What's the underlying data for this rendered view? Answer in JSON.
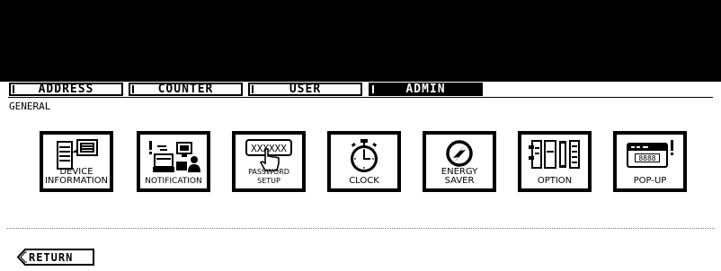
{
  "tabs": [
    {
      "label": "ADDRESS",
      "active": false
    },
    {
      "label": "COUNTER",
      "active": false
    },
    {
      "label": "USER",
      "active": false
    },
    {
      "label": "ADMIN",
      "active": true
    }
  ],
  "section_label": "GENERAL",
  "buttons": [
    {
      "label": "DEVICE\nINFORMATION",
      "icon": "device-information-icon"
    },
    {
      "label": "NOTIFICATION",
      "icon": "notification-icon"
    },
    {
      "label": "PASSWORD SETUP",
      "icon": "password-setup-icon",
      "icon_text": "XXXXXX"
    },
    {
      "label": "CLOCK",
      "icon": "clock-icon"
    },
    {
      "label": "ENERGY\nSAVER",
      "icon": "energy-saver-icon"
    },
    {
      "label": "OPTION",
      "icon": "option-icon"
    },
    {
      "label": "POP-UP",
      "icon": "pop-up-icon",
      "icon_text": "8888"
    }
  ],
  "return_label": "RETURN",
  "colors": {
    "header": "#000000",
    "active_tab": "#000000",
    "background": "#ffffff"
  }
}
